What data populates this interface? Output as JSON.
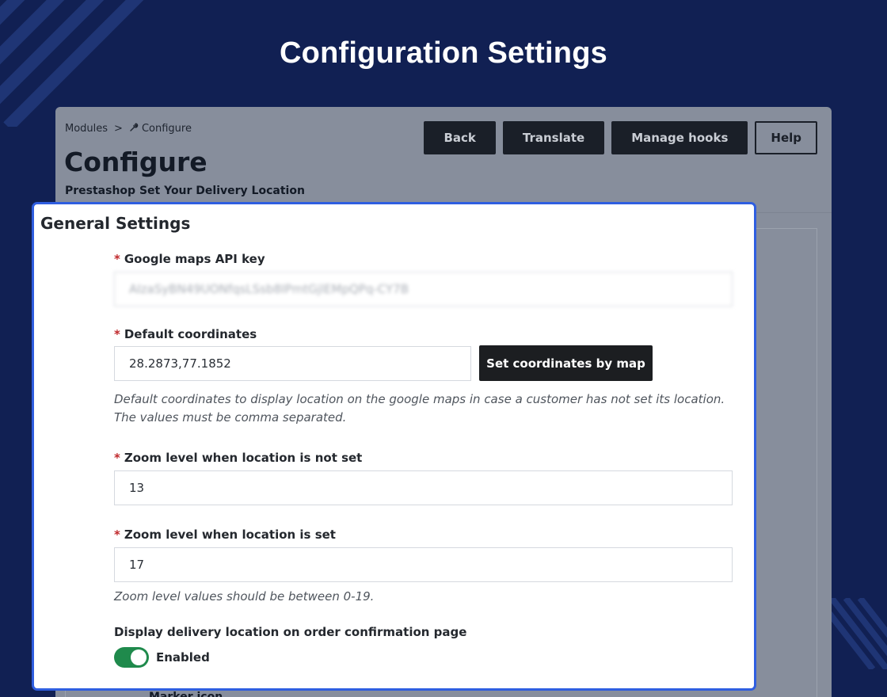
{
  "page": {
    "heading": "Configuration Settings"
  },
  "admin": {
    "breadcrumb": {
      "parent": "Modules",
      "separator": ">",
      "current": "Configure",
      "current_icon": "wrench-icon"
    },
    "title": "Configure",
    "subtitle": "Prestashop Set Your Delivery Location",
    "toolbar": {
      "back": "Back",
      "translate": "Translate",
      "manage_hooks": "Manage hooks",
      "help": "Help"
    },
    "next_field_label": "Marker icon"
  },
  "settings": {
    "title": "General Settings",
    "required_mark": "*",
    "api_key": {
      "label": "Google maps API key",
      "value": "AIzaSyBN49UONfqsLSsb8IPmtGjlEMpQPq-CY7B"
    },
    "coordinates": {
      "label": "Default coordinates",
      "value": "28.2873,77.1852",
      "button": "Set coordinates by map",
      "help": "Default coordinates to display location on the google maps in case a customer has not set its location. The values must be comma separated."
    },
    "zoom_not_set": {
      "label": "Zoom level when location is not set",
      "value": "13"
    },
    "zoom_set": {
      "label": "Zoom level when location is set",
      "value": "17",
      "help": "Zoom level values should be between 0-19."
    },
    "display_location": {
      "label": "Display delivery location on order confirmation page",
      "state": "Enabled",
      "enabled": true
    }
  },
  "colors": {
    "background": "#112053",
    "accent_border": "#2f5ee0",
    "toggle_on": "#1f8a4c",
    "required": "#c0282b"
  }
}
